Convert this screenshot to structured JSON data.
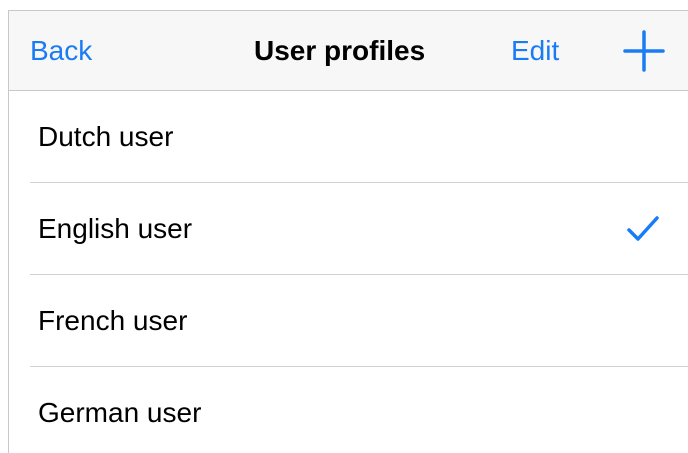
{
  "navbar": {
    "back_label": "Back",
    "title": "User profiles",
    "edit_label": "Edit",
    "add_icon": "plus-icon"
  },
  "profiles": [
    {
      "label": "Dutch user",
      "selected": false
    },
    {
      "label": "English user",
      "selected": true
    },
    {
      "label": "French user",
      "selected": false
    },
    {
      "label": "German user",
      "selected": false
    }
  ],
  "colors": {
    "accent": "#1a7cf5",
    "navbar_background": "#f7f7f7",
    "separator": "#d1d1d6"
  },
  "icons": {
    "selected_indicator": "checkmark-icon"
  }
}
